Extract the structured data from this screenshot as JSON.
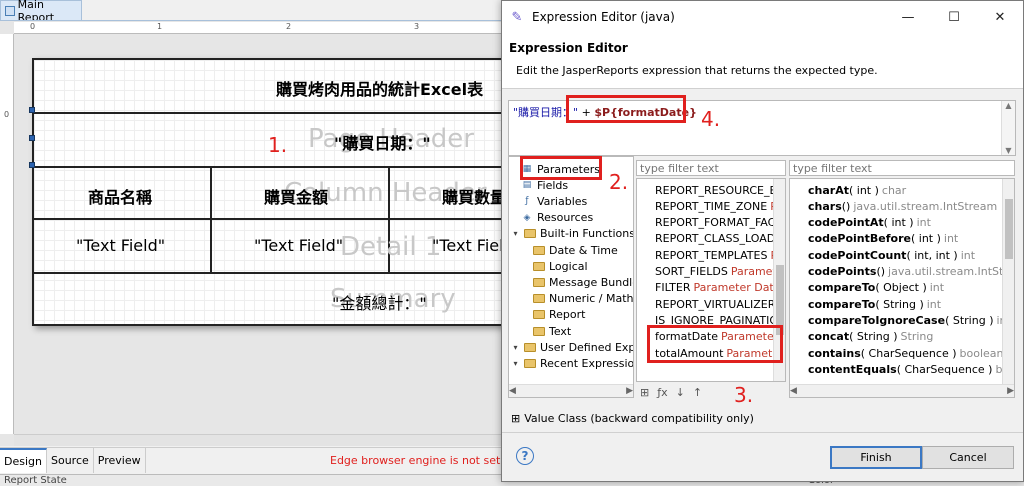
{
  "main_tab": {
    "label": "Main Report"
  },
  "ruler": {
    "top_marks": [
      "0",
      "1",
      "2",
      "3"
    ],
    "left_marks": [
      "0"
    ]
  },
  "report": {
    "title": "購買烤肉用品的統計Excel表",
    "date_expr": "\"購買日期：\"",
    "headers": [
      "商品名稱",
      "購買金額",
      "購買數量"
    ],
    "fields": [
      "\"Text Field\"",
      "\"Text Field\"",
      "\"Text Fiel"
    ],
    "summary_expr": "\"金額總計：\"",
    "band_labels": {
      "page_header": "Page Header",
      "column_header": "Column Header",
      "detail": "Detail 1",
      "summary": "Summary"
    }
  },
  "annotations": {
    "n1": "1.",
    "n2": "2.",
    "n3": "3.",
    "n4": "4."
  },
  "designer_tabs": [
    "Design",
    "Source",
    "Preview"
  ],
  "status_message": "Edge browser engine is not setup. HT",
  "bottom_bar": {
    "left": "Report State",
    "right": "Color"
  },
  "dialog": {
    "window_title": "Expression Editor (java)",
    "heading": "Expression Editor",
    "description": "Edit the JasperReports expression that returns the expected type.",
    "expression": {
      "string_part": "\"購買日期：\"",
      "operator": " + ",
      "param_part": "$P{formatDate}"
    },
    "categories": [
      {
        "label": "Parameters",
        "icon": "parameters-icon",
        "indent": 0
      },
      {
        "label": "Fields",
        "icon": "fields-icon",
        "indent": 0
      },
      {
        "label": "Variables",
        "icon": "variables-icon",
        "indent": 0
      },
      {
        "label": "Resources",
        "icon": "resources-icon",
        "indent": 0
      },
      {
        "label": "Built-in Functions",
        "icon": "folder-icon",
        "indent": 0,
        "expandable": true
      },
      {
        "label": "Date & Time",
        "icon": "folder-icon",
        "indent": 1
      },
      {
        "label": "Logical",
        "icon": "folder-icon",
        "indent": 1
      },
      {
        "label": "Message Bundles",
        "icon": "folder-icon",
        "indent": 1
      },
      {
        "label": "Numeric / Mathe",
        "icon": "folder-icon",
        "indent": 1
      },
      {
        "label": "Report",
        "icon": "folder-icon",
        "indent": 1
      },
      {
        "label": "Text",
        "icon": "folder-icon",
        "indent": 1
      },
      {
        "label": "User Defined Expres",
        "icon": "folder-icon",
        "indent": 0,
        "expandable": true
      },
      {
        "label": "Recent Expressions",
        "icon": "folder-icon",
        "indent": 0,
        "expandable": true
      }
    ],
    "filter_placeholder_middle": "type filter text",
    "filter_placeholder_right": "type filter text",
    "params": [
      {
        "name": "REPORT_RESOURCE_BUN",
        "type": ""
      },
      {
        "name": "REPORT_TIME_ZONE",
        "type": "Para"
      },
      {
        "name": "REPORT_FORMAT_FACTO",
        "type": ""
      },
      {
        "name": "REPORT_CLASS_LOADER",
        "type": ""
      },
      {
        "name": "REPORT_TEMPLATES",
        "type": "Para"
      },
      {
        "name": "SORT_FIELDS",
        "type": "Parameter"
      },
      {
        "name": "FILTER",
        "type": "Parameter Datase"
      },
      {
        "name": "REPORT_VIRTUALIZER",
        "type": "Pa"
      },
      {
        "name": "IS_IGNORE_PAGINATION",
        "type": ""
      },
      {
        "name": "formatDate",
        "type": "Parameter St"
      },
      {
        "name": "totalAmount",
        "type": "Parameter I"
      }
    ],
    "methods": [
      {
        "name": "charAt",
        "args": "( int )",
        "ret": "char"
      },
      {
        "name": "chars",
        "args": "()",
        "ret": "java.util.stream.IntStream"
      },
      {
        "name": "codePointAt",
        "args": "( int )",
        "ret": "int"
      },
      {
        "name": "codePointBefore",
        "args": "( int )",
        "ret": "int"
      },
      {
        "name": "codePointCount",
        "args": "( int, int )",
        "ret": "int"
      },
      {
        "name": "codePoints",
        "args": "()",
        "ret": "java.util.stream.IntStream"
      },
      {
        "name": "compareTo",
        "args": "( Object )",
        "ret": "int"
      },
      {
        "name": "compareTo",
        "args": "( String )",
        "ret": "int"
      },
      {
        "name": "compareToIgnoreCase",
        "args": "( String )",
        "ret": "int"
      },
      {
        "name": "concat",
        "args": "( String )",
        "ret": "String"
      },
      {
        "name": "contains",
        "args": "( CharSequence )",
        "ret": "boolean"
      },
      {
        "name": "contentEquals",
        "args": "( CharSequence )",
        "ret": "boolea"
      }
    ],
    "value_class": "Value Class (backward compatibility only)",
    "buttons": {
      "finish": "Finish",
      "cancel": "Cancel"
    }
  }
}
